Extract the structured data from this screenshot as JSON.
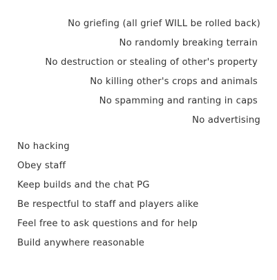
{
  "right_rules": [
    "No griefing (all grief WILL be rolled back)",
    "No randomly breaking terrain",
    "No destruction or stealing of other's property",
    "No killing other's crops and animals",
    "No spamming and ranting in caps",
    "No advertising"
  ],
  "left_rules": [
    "No hacking",
    "Obey staff",
    "Keep builds and the chat PG",
    "Be respectful to staff and players alike",
    "Feel free to ask questions and for help",
    "Build anywhere reasonable"
  ]
}
